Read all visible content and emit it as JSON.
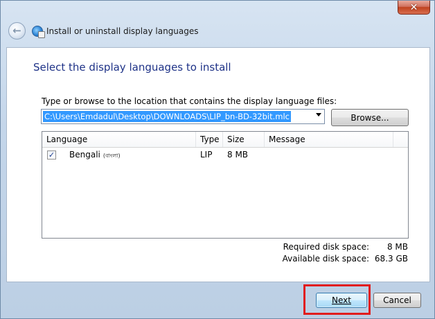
{
  "window": {
    "title": "Install or uninstall display languages",
    "close_glyph": "✕",
    "back_glyph": "←"
  },
  "page": {
    "heading": "Select the display languages to install",
    "path_label": "Type or browse to the location that contains the display language files:",
    "path_value": "C:\\Users\\Emdadul\\Desktop\\DOWNLOADS\\LIP_bn-BD-32bit.mlc",
    "browse_label": "Browse..."
  },
  "table": {
    "columns": [
      "Language",
      "Type",
      "Size",
      "Message"
    ],
    "rows": [
      {
        "checked": true,
        "language": "Bengali",
        "native": "(বাংলা)",
        "type": "LIP",
        "size": "8 MB",
        "message": ""
      }
    ]
  },
  "disk": {
    "required_label": "Required disk space:",
    "required_value": "8 MB",
    "available_label": "Available disk space:",
    "available_value": "68.3 GB"
  },
  "footer": {
    "next_label": "Next",
    "cancel_label": "Cancel"
  },
  "colors": {
    "heading": "#1e3287",
    "selection": "#3399ff",
    "highlight_box": "#e11d1d"
  }
}
